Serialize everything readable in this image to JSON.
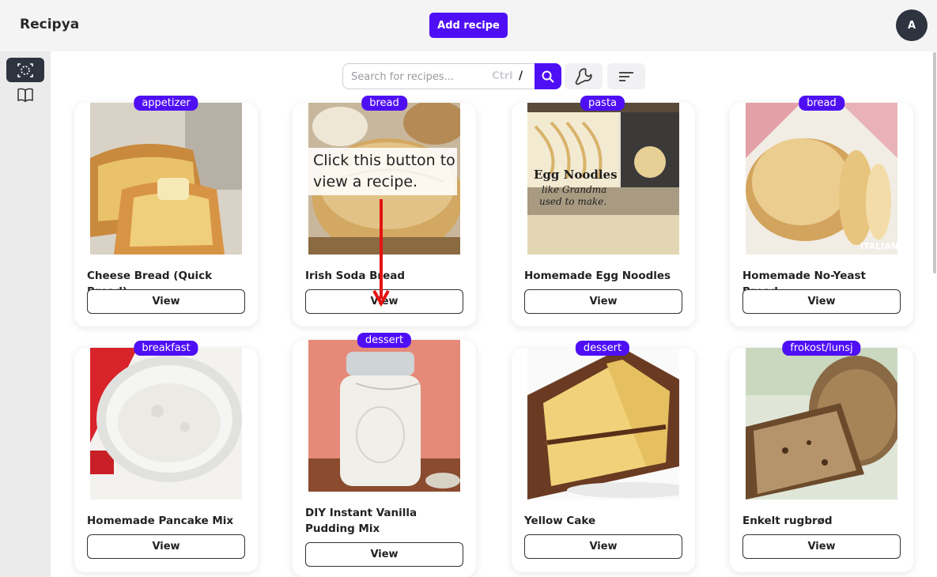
{
  "app": {
    "title": "Recipya"
  },
  "header": {
    "add_label": "Add recipe",
    "avatar_initial": "A"
  },
  "search": {
    "placeholder": "Search for recipes...",
    "shortcut_ctrl": "Ctrl",
    "shortcut_key": "/"
  },
  "tooltip": {
    "text": "Click this button to view a recipe."
  },
  "colors": {
    "accent": "#4f0ff5",
    "dark": "#2e3340",
    "topbar": "#f4f4f5",
    "rail": "#ebebec"
  },
  "recipes": [
    {
      "title": "Cheese Bread (Quick Bread)",
      "category": "appetizer",
      "view_label": "View"
    },
    {
      "title": "Irish Soda Bread",
      "category": "bread",
      "view_label": "View"
    },
    {
      "title": "Homemade Egg Noodles",
      "category": "pasta",
      "view_label": "View",
      "image_caption": [
        "Egg Noodles",
        "like Grandma",
        "used to make."
      ]
    },
    {
      "title": "Homemade No-Yeast Bread",
      "category": "bread",
      "view_label": "View",
      "image_watermark": "ITALIAN"
    },
    {
      "title": "Homemade Pancake Mix",
      "category": "breakfast",
      "view_label": "View"
    },
    {
      "title": "DIY Instant Vanilla Pudding Mix",
      "category": "dessert",
      "view_label": "View"
    },
    {
      "title": "Yellow Cake",
      "category": "dessert",
      "view_label": "View"
    },
    {
      "title": "Enkelt rugbrød",
      "category": "frokost/lunsj",
      "view_label": "View"
    }
  ]
}
